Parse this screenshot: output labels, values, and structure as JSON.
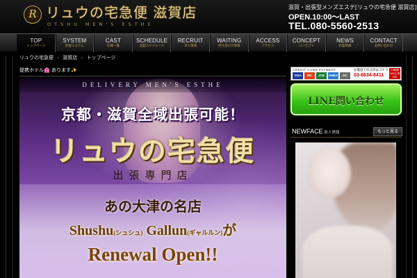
{
  "header": {
    "logo_text": "リュウの宅急便 滋賀店",
    "logo_sub": "OTSHU MEN'S ESTHE",
    "shop_description": "滋賀・出張型メンズエステ[リュウの宅急便 滋賀店]",
    "hours": "OPEN.10:00～LAST",
    "tel": "TEL.080-5560-2513"
  },
  "nav": {
    "items": [
      {
        "label": "TOP",
        "sub": "トップページ"
      },
      {
        "label": "SYSTEM",
        "sub": "料金システム"
      },
      {
        "label": "CAST",
        "sub": "在籍一覧"
      },
      {
        "label": "SCHEDULE",
        "sub": "出勤スケジュール"
      },
      {
        "label": "RECRUIT",
        "sub": "求人情報"
      },
      {
        "label": "WAITING",
        "sub": "待ち合わせ情報"
      },
      {
        "label": "ACCESS",
        "sub": "アクセス"
      },
      {
        "label": "CONCEPT",
        "sub": "コンセプト"
      },
      {
        "label": "NEWS",
        "sub": "新着情報"
      },
      {
        "label": "CONTACT",
        "sub": "お問い合わせ"
      }
    ]
  },
  "breadcrumb": {
    "items": [
      "リュウの宅急便",
      "滋賀店",
      "トップページ"
    ],
    "separator": "›"
  },
  "notice": {
    "text": "提携ホテル🏩 あります✨"
  },
  "banner": {
    "tagline": "DELIVERY MEN'S ESTHE",
    "area": "京都・滋賀全域出張可能！",
    "brand": "リュウの宅急便",
    "service_type": "出張専門店",
    "famous": "あの大津の名店",
    "shop1": "Shushu",
    "shop1_kana": "(シュシュ)",
    "shop2": "Gallun",
    "shop2_kana": "(ギャルルン)",
    "particle": "が",
    "renewal": "Renewal Open!!"
  },
  "payment": {
    "title": "CREDIT CARD PAYMENT",
    "cards": [
      "VISA",
      "MC",
      "JCB",
      "AMEX",
      "DC"
    ],
    "phone_label": "お電話での決済はコチラ",
    "phone": "03-6634-8411",
    "badge": "24時間 365日 受付中"
  },
  "line_button": {
    "label": "LINE問い合わせ"
  },
  "newface": {
    "title": "NEWFACE",
    "subtitle": "新人情報",
    "more_label": "もっと見る"
  },
  "colors": {
    "accent_gold": "#c9a85a",
    "line_green": "#3cc41a",
    "banner_purple": "#7d4aa6"
  }
}
